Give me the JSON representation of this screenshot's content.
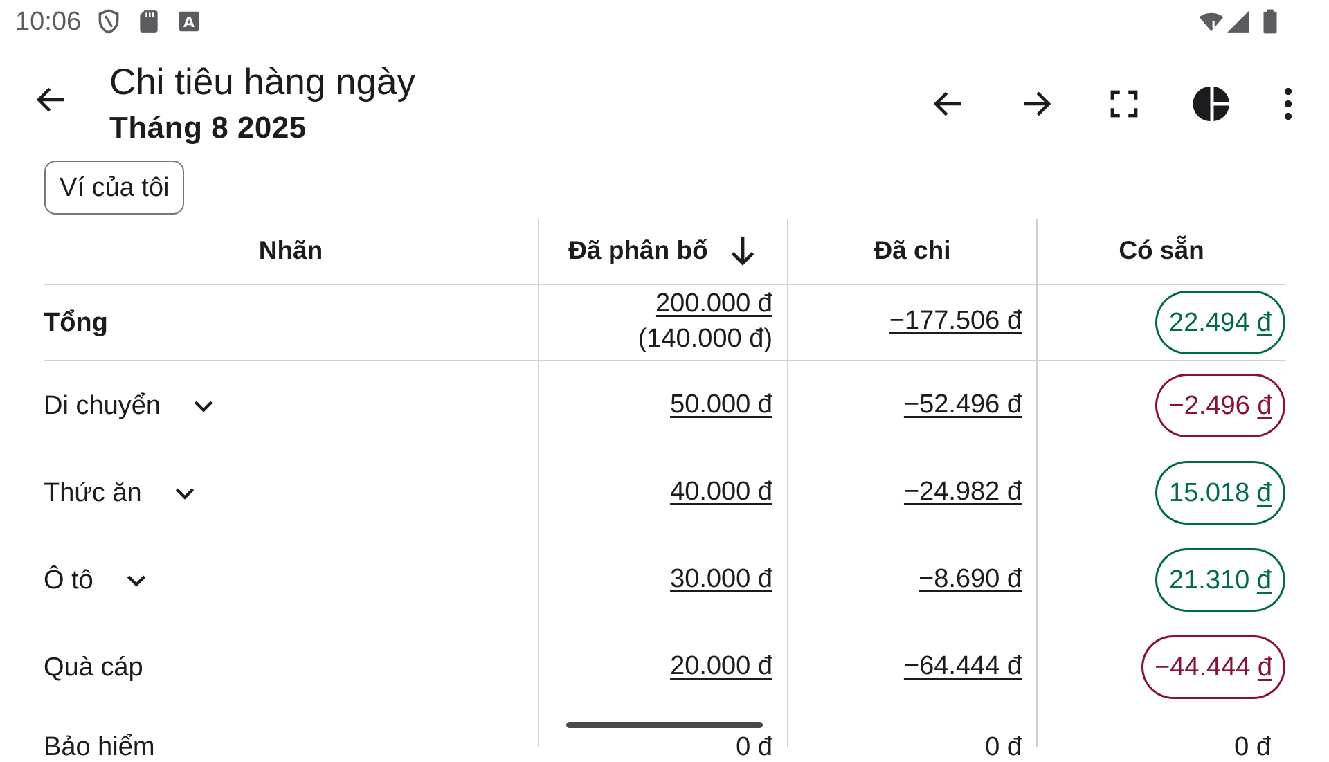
{
  "status_bar": {
    "time": "10:06",
    "left_icons": [
      "shield-icon",
      "sd-card-icon",
      "a-box-icon"
    ],
    "right_icons": [
      "wifi-icon",
      "signal-icon",
      "battery-icon"
    ]
  },
  "app_bar": {
    "title": "Chi tiêu hàng ngày",
    "subtitle": "Tháng 8 2025",
    "actions": [
      "back-arrow-icon",
      "previous-arrow-icon",
      "next-arrow-icon",
      "fullscreen-icon",
      "pie-chart-icon",
      "more-vert-icon"
    ]
  },
  "filter_chip": {
    "label": "Ví của tôi"
  },
  "table": {
    "headers": {
      "label": "Nhãn",
      "allocated": "Đã phân bố",
      "spent": "Đã chi",
      "available": "Có sẵn"
    },
    "sort_icon": "arrow-down-icon",
    "total": {
      "label": "Tổng",
      "allocated": "200.000 đ",
      "allocated_sub": "(140.000 đ)",
      "spent": "−177.506 đ",
      "available_num": "22.494",
      "available_unit": "đ",
      "available_status": "positive"
    },
    "rows": [
      {
        "label": "Di chuyển",
        "expandable": true,
        "allocated": "50.000 đ",
        "spent": "−52.496 đ",
        "available_num": "−2.496",
        "available_unit": "đ",
        "status": "negative"
      },
      {
        "label": "Thức ăn",
        "expandable": true,
        "allocated": "40.000 đ",
        "spent": "−24.982 đ",
        "available_num": "15.018",
        "available_unit": "đ",
        "status": "positive"
      },
      {
        "label": "Ô tô",
        "expandable": true,
        "allocated": "30.000 đ",
        "spent": "−8.690 đ",
        "available_num": "21.310",
        "available_unit": "đ",
        "status": "positive"
      },
      {
        "label": "Quà cáp",
        "expandable": false,
        "allocated": "20.000 đ",
        "spent": "−64.444 đ",
        "available_num": "−44.444",
        "available_unit": "đ",
        "status": "negative"
      }
    ],
    "partial_row": {
      "label": "Bảo hiểm",
      "allocated": "0 đ",
      "spent": "0 đ",
      "available": "0 đ"
    }
  },
  "colors": {
    "positive": "#006a4e",
    "negative": "#8a0f3a",
    "divider": "#d0d0d0"
  }
}
